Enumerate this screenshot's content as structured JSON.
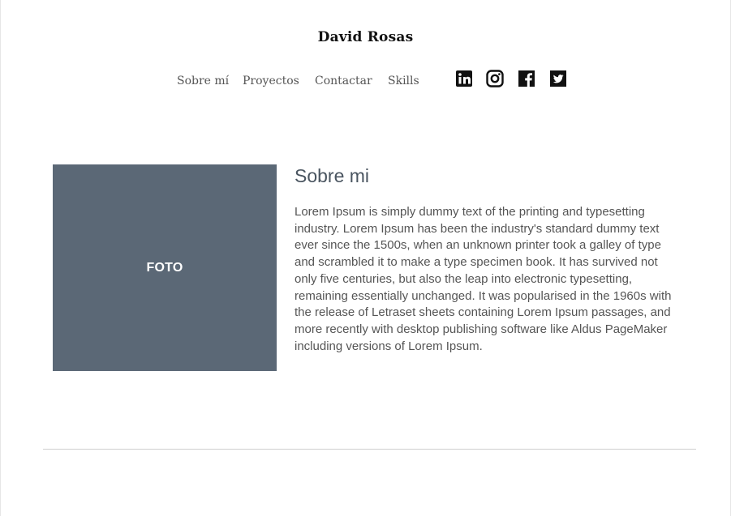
{
  "header": {
    "site_title": "David Rosas"
  },
  "nav": {
    "items": [
      {
        "label": "Sobre mí"
      },
      {
        "label": "Proyectos"
      },
      {
        "label": "Contactar"
      },
      {
        "label": "Skills"
      }
    ]
  },
  "social": [
    {
      "icon": "linkedin-icon"
    },
    {
      "icon": "instagram-icon"
    },
    {
      "icon": "facebook-icon"
    },
    {
      "icon": "twitter-icon"
    }
  ],
  "about": {
    "photo_label": "FOTO",
    "heading": "Sobre mi",
    "body": "Lorem Ipsum is simply dummy text of the printing and typesetting\nindustry. Lorem Ipsum has been the industry's standard dummy text\never since the 1500s, when an unknown printer took a galley of type\n and scrambled it to make a type specimen book. It has survived not\n only five centuries, but also the leap into electronic typesetting,\nremaining essentially unchanged. It was popularised in the 1960s with\nthe release of Letraset sheets containing Lorem Ipsum passages, and\n more recently with desktop publishing software like Aldus PageMaker\nincluding versions of Lorem Ipsum."
  },
  "colors": {
    "photo_bg": "#5b6876",
    "heading": "#4a5560",
    "text": "#555555",
    "divider": "#cfcfcf"
  }
}
